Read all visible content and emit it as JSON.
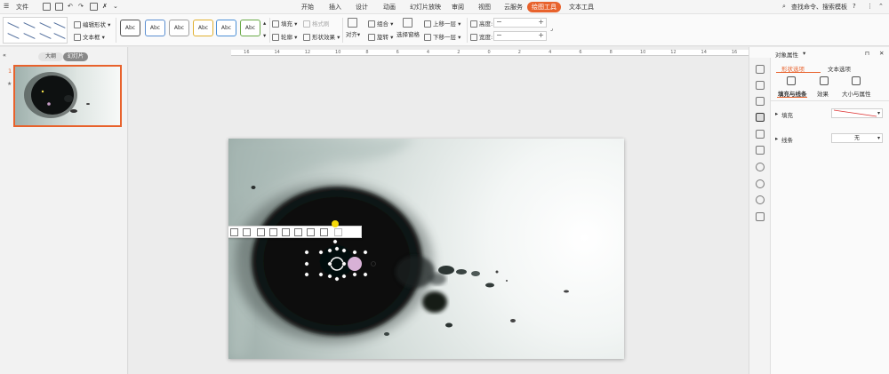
{
  "menubar": {
    "file_label": "文件",
    "tabs": [
      "开始",
      "插入",
      "设计",
      "动画",
      "幻灯片放映",
      "审阅",
      "视图",
      "云服务"
    ],
    "active_tab": "绘图工具",
    "text_tool_tab": "文本工具",
    "search_placeholder": "查找命令、搜索模板",
    "help_label": "?"
  },
  "ribbon": {
    "edit_shape": "编辑形状",
    "text_box": "文本框",
    "style_abc": [
      "Abc",
      "Abc",
      "Abc",
      "Abc",
      "Abc",
      "Abc"
    ],
    "fill": "填充",
    "format_painter": "格式刷",
    "outline": "轮廓",
    "shape_effect": "形状效果",
    "align": "对齐",
    "group": "组合",
    "rotate": "旋转",
    "select_pane": "选择窗格",
    "bring_forward": "上移一层",
    "send_backward": "下移一层",
    "height_label": "高度:",
    "width_label": "宽度:",
    "minus": "−",
    "plus": "+"
  },
  "leftpanel": {
    "tab_outline": "大纲",
    "tab_slides": "幻灯片",
    "slide_number": "1",
    "star": "★"
  },
  "ruler": {
    "labels": [
      "16",
      "14",
      "12",
      "10",
      "8",
      "6",
      "4",
      "2",
      "0",
      "2",
      "4",
      "6",
      "8",
      "10",
      "12",
      "14",
      "16"
    ]
  },
  "rightpanel": {
    "title": "对象属性",
    "tab_shape": "形状选项",
    "tab_text": "文本选项",
    "sub_fill_line": "填充与线条",
    "sub_effect": "效果",
    "sub_size": "大小与属性",
    "fill_label": "填充",
    "line_label": "线条",
    "line_value": "无"
  },
  "colors": {
    "accent": "#e8622c",
    "ink": "#0d0f0f"
  }
}
